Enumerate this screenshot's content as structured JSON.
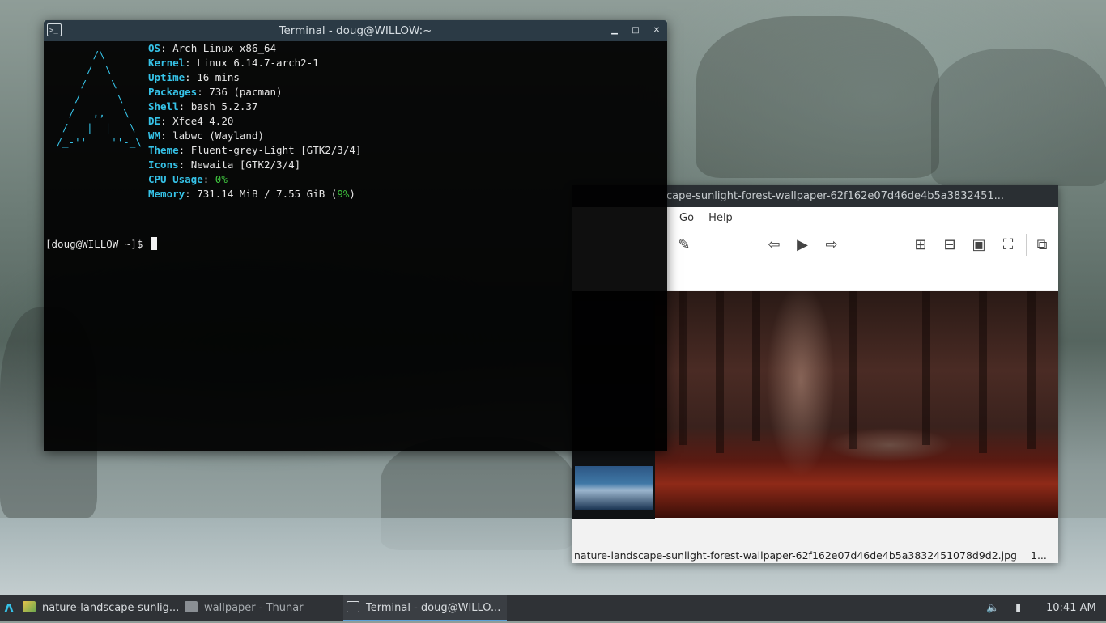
{
  "terminal": {
    "title": "Terminal - doug@WILLOW:~",
    "controls": {
      "minimize": "▁",
      "maximize": "□",
      "close": "✕"
    },
    "logo": "       /\\\n      /  \\\n     /    \\\n    /      \\\n   /   ,,   \\\n  /   |  |   \\\n /_-''    ''-_\\",
    "fetch": [
      {
        "key": "OS",
        "value": ": Arch Linux x86_64"
      },
      {
        "key": "Kernel",
        "value": ": Linux 6.14.7-arch2-1"
      },
      {
        "key": "Uptime",
        "value": ": 16 mins"
      },
      {
        "key": "Packages",
        "value": ": 736 (pacman)"
      },
      {
        "key": "Shell",
        "value": ": bash 5.2.37"
      },
      {
        "key": "DE",
        "value": ": Xfce4 4.20"
      },
      {
        "key": "WM",
        "value": ": labwc (Wayland)"
      },
      {
        "key": "Theme",
        "value": ": Fluent-grey-Light [GTK2/3/4]"
      },
      {
        "key": "Icons",
        "value": ": Newaita [GTK2/3/4]"
      },
      {
        "key": "CPU Usage",
        "value": ": ",
        "highlight": "0%"
      },
      {
        "key": "Memory",
        "value": ": 731.14 MiB / 7.55 GiB (",
        "highlight": "9%",
        "tail": ")"
      }
    ],
    "prompt": "[doug@WILLOW ~]$ "
  },
  "viewer": {
    "title": "cape-sunlight-forest-wallpaper-62f162e07d46de4b5a3832451...",
    "menu": [
      "Go",
      "Help"
    ],
    "toolbar": {
      "edit": "✎",
      "prev": "⇦",
      "play": "▶",
      "next": "⇨",
      "zoom_in": "⊞",
      "zoom_out": "⊟",
      "zoom_fit": "▣",
      "zoom_100": "⛶",
      "fullscreen": "⧉"
    },
    "status_filename": "nature-landscape-sunlight-forest-wallpaper-62f162e07d46de4b5a3832451078d9d2.jpg",
    "status_extra": "1..."
  },
  "taskbar": {
    "launcher_icon": "arch-logo-icon",
    "tasks": [
      {
        "label": "nature-landscape-sunlig...",
        "icon": "image-viewer-icon"
      },
      {
        "label": "wallpaper - Thunar",
        "icon": "file-manager-icon"
      },
      {
        "label": "Terminal - doug@WILLO...",
        "icon": "terminal-icon"
      }
    ],
    "tray": {
      "volume": "🔈",
      "battery": "▮",
      "clock": "10:41 AM"
    }
  },
  "colors": {
    "accent": "#36c3e8",
    "ok_green": "#3fc43f",
    "panel": "#2f3236"
  }
}
